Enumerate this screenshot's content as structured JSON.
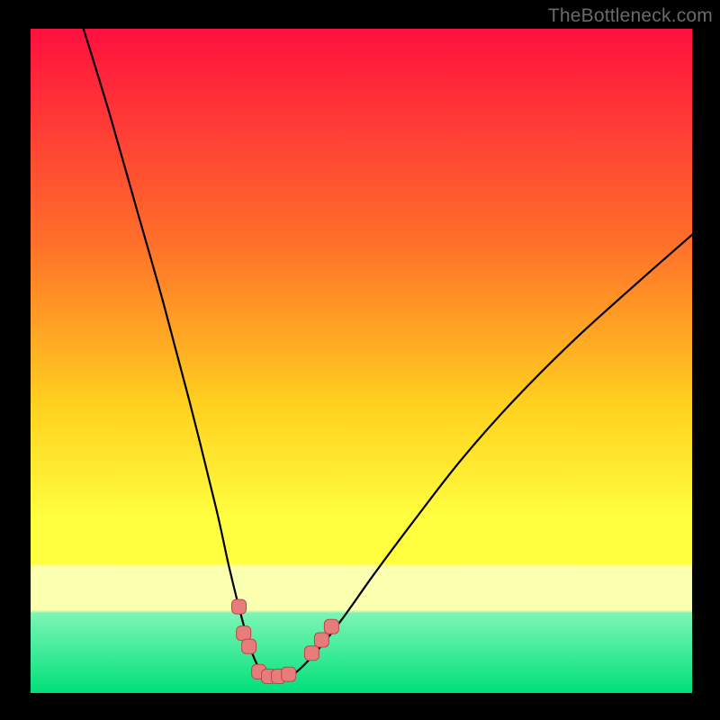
{
  "watermark": "TheBottleneck.com",
  "colors": {
    "black": "#000000",
    "grad_top": "#ff103f",
    "grad_30": "#ff6f2a",
    "grad_55": "#ffd21f",
    "grad_72": "#ffff40",
    "grad_band_pale": "#fbffb0",
    "grad_band_mint": "#7cf5b5",
    "grad_bottom": "#00e07a",
    "curve": "#000000",
    "marker_fill": "#e77c7c",
    "marker_stroke": "#bb4a4a"
  },
  "chart_data": {
    "type": "line",
    "title": "",
    "xlabel": "",
    "ylabel": "",
    "xlim": [
      0,
      100
    ],
    "ylim": [
      0,
      100
    ],
    "series": [
      {
        "name": "bottleneck-curve",
        "x": [
          8,
          12,
          16,
          20,
          24,
          28,
          30,
          32,
          33.5,
          35,
          36.5,
          38,
          40,
          43,
          47,
          52,
          58,
          65,
          73,
          82,
          92,
          100
        ],
        "y": [
          100,
          87,
          73,
          59,
          44,
          28,
          19,
          11,
          6,
          3,
          2,
          2,
          3,
          6,
          11,
          18,
          26,
          35,
          44,
          53,
          62,
          69
        ]
      }
    ],
    "markers": [
      {
        "name": "left-cluster-1",
        "x": 31.5,
        "y": 13
      },
      {
        "name": "left-cluster-2",
        "x": 32.2,
        "y": 9
      },
      {
        "name": "left-cluster-3",
        "x": 33.0,
        "y": 7
      },
      {
        "name": "floor-1",
        "x": 34.5,
        "y": 3.2
      },
      {
        "name": "floor-2",
        "x": 36.0,
        "y": 2.5
      },
      {
        "name": "floor-3",
        "x": 37.5,
        "y": 2.5
      },
      {
        "name": "floor-4",
        "x": 39.0,
        "y": 2.8
      },
      {
        "name": "right-cluster-1",
        "x": 42.5,
        "y": 6
      },
      {
        "name": "right-cluster-2",
        "x": 44.0,
        "y": 8
      },
      {
        "name": "right-cluster-3",
        "x": 45.5,
        "y": 10
      }
    ]
  }
}
